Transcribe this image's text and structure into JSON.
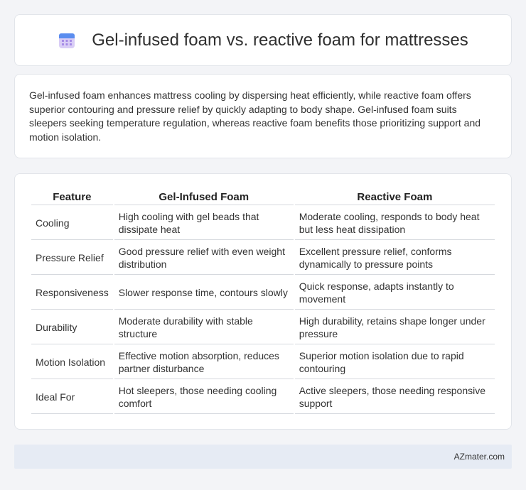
{
  "header": {
    "title": "Gel-infused foam vs. reactive foam for mattresses",
    "icon": "calendar-icon"
  },
  "summary": {
    "text": "Gel-infused foam enhances mattress cooling by dispersing heat efficiently, while reactive foam offers superior contouring and pressure relief by quickly adapting to body shape. Gel-infused foam suits sleepers seeking temperature regulation, whereas reactive foam benefits those prioritizing support and motion isolation."
  },
  "table": {
    "headers": [
      "Feature",
      "Gel-Infused Foam",
      "Reactive Foam"
    ],
    "rows": [
      [
        "Cooling",
        "High cooling with gel beads that dissipate heat",
        "Moderate cooling, responds to body heat but less heat dissipation"
      ],
      [
        "Pressure Relief",
        "Good pressure relief with even weight distribution",
        "Excellent pressure relief, conforms dynamically to pressure points"
      ],
      [
        "Responsiveness",
        "Slower response time, contours slowly",
        "Quick response, adapts instantly to movement"
      ],
      [
        "Durability",
        "Moderate durability with stable structure",
        "High durability, retains shape longer under pressure"
      ],
      [
        "Motion Isolation",
        "Effective motion absorption, reduces partner disturbance",
        "Superior motion isolation due to rapid contouring"
      ],
      [
        "Ideal For",
        "Hot sleepers, those needing cooling comfort",
        "Active sleepers, those needing responsive support"
      ]
    ]
  },
  "footer": {
    "brand": "AZmater.com"
  },
  "colors": {
    "background": "#f3f4f7",
    "card": "#ffffff",
    "footer": "#e6ebf4",
    "icon_top": "#5b8def",
    "icon_body": "#c9b8f0"
  }
}
